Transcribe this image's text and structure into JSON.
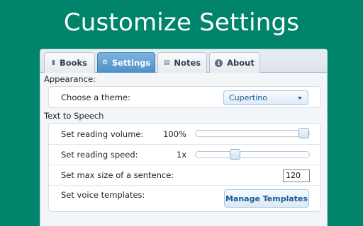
{
  "headline": "Customize Settings",
  "tabs": [
    {
      "label": "Books",
      "icon": "book-icon"
    },
    {
      "label": "Settings",
      "icon": "gear-icon"
    },
    {
      "label": "Notes",
      "icon": "note-icon"
    },
    {
      "label": "About",
      "icon": "info-icon"
    }
  ],
  "active_tab": "Settings",
  "appearance": {
    "title": "Appearance:",
    "theme_label": "Choose a theme:",
    "theme_value": "Cupertino"
  },
  "tts": {
    "title": "Text to Speech",
    "volume_label": "Set reading volume:",
    "volume_value": "100%",
    "volume_level": 1.0,
    "speed_label": "Set reading speed:",
    "speed_value": "1x",
    "speed_level": 0.33,
    "max_sentence_label": "Set max size of a sentence:",
    "max_sentence_value": "120",
    "templates_label": "Set voice templates:",
    "templates_button": "Manage Templates"
  },
  "colors": {
    "background": "#00846b",
    "active_tab": "#4e8fc7",
    "accent_text": "#1b5a94"
  }
}
